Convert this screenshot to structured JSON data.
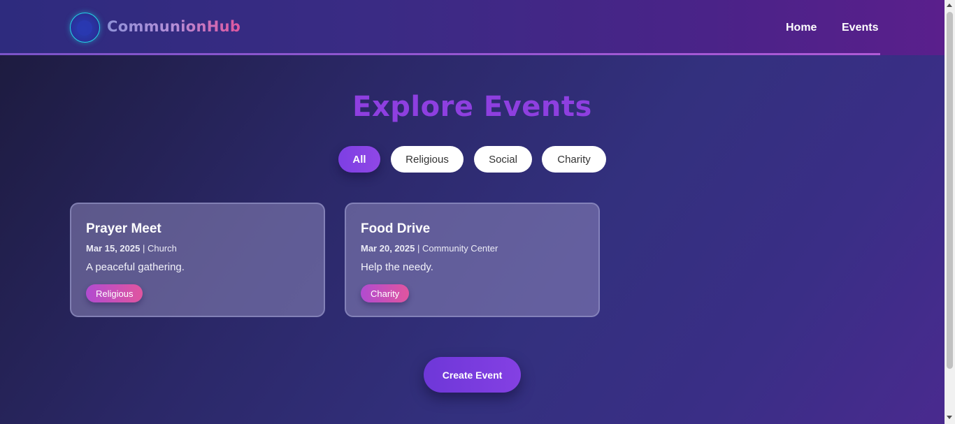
{
  "header": {
    "brand": "CommunionHub",
    "nav": [
      {
        "label": "Home"
      },
      {
        "label": "Events"
      }
    ]
  },
  "main": {
    "title": "Explore Events",
    "filters": [
      {
        "label": "All",
        "active": true
      },
      {
        "label": "Religious",
        "active": false
      },
      {
        "label": "Social",
        "active": false
      },
      {
        "label": "Charity",
        "active": false
      }
    ],
    "events": [
      {
        "title": "Prayer Meet",
        "date": "Mar 15, 2025",
        "location": "| Church",
        "description": "A peaceful gathering.",
        "tag": "Religious"
      },
      {
        "title": "Food Drive",
        "date": "Mar 20, 2025",
        "location": "| Community Center",
        "description": "Help the needy.",
        "tag": "Charity"
      }
    ],
    "create_button": "Create Event"
  },
  "colors": {
    "accent": "#8e3fe0",
    "tag_gradient_start": "#b14bd0",
    "tag_gradient_end": "#e0559f",
    "logo_ring": "#22d6e8"
  },
  "icons": {
    "logo": "logo-icon"
  }
}
